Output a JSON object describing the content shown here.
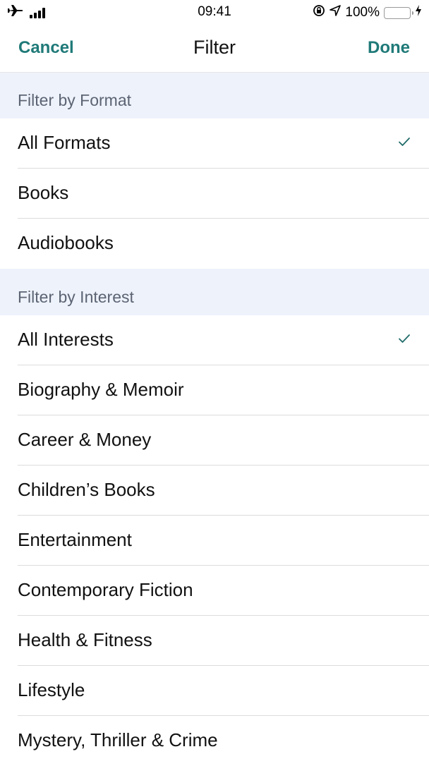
{
  "status_bar": {
    "time": "09:41",
    "battery_percent": "100%",
    "icons": [
      "airplane-icon",
      "signal-icon",
      "rotation-lock-icon",
      "location-icon",
      "battery-icon",
      "charging-icon"
    ]
  },
  "nav": {
    "cancel_label": "Cancel",
    "title": "Filter",
    "done_label": "Done",
    "accent_color": "#1f7a78"
  },
  "sections": [
    {
      "header": "Filter by Format",
      "items": [
        {
          "label": "All Formats",
          "selected": true
        },
        {
          "label": "Books",
          "selected": false
        },
        {
          "label": "Audiobooks",
          "selected": false
        }
      ]
    },
    {
      "header": "Filter by Interest",
      "items": [
        {
          "label": "All Interests",
          "selected": true
        },
        {
          "label": "Biography & Memoir",
          "selected": false
        },
        {
          "label": "Career & Money",
          "selected": false
        },
        {
          "label": "Children’s Books",
          "selected": false
        },
        {
          "label": "Entertainment",
          "selected": false
        },
        {
          "label": "Contemporary Fiction",
          "selected": false
        },
        {
          "label": "Health & Fitness",
          "selected": false
        },
        {
          "label": "Lifestyle",
          "selected": false
        },
        {
          "label": "Mystery, Thriller & Crime",
          "selected": false
        }
      ]
    }
  ]
}
